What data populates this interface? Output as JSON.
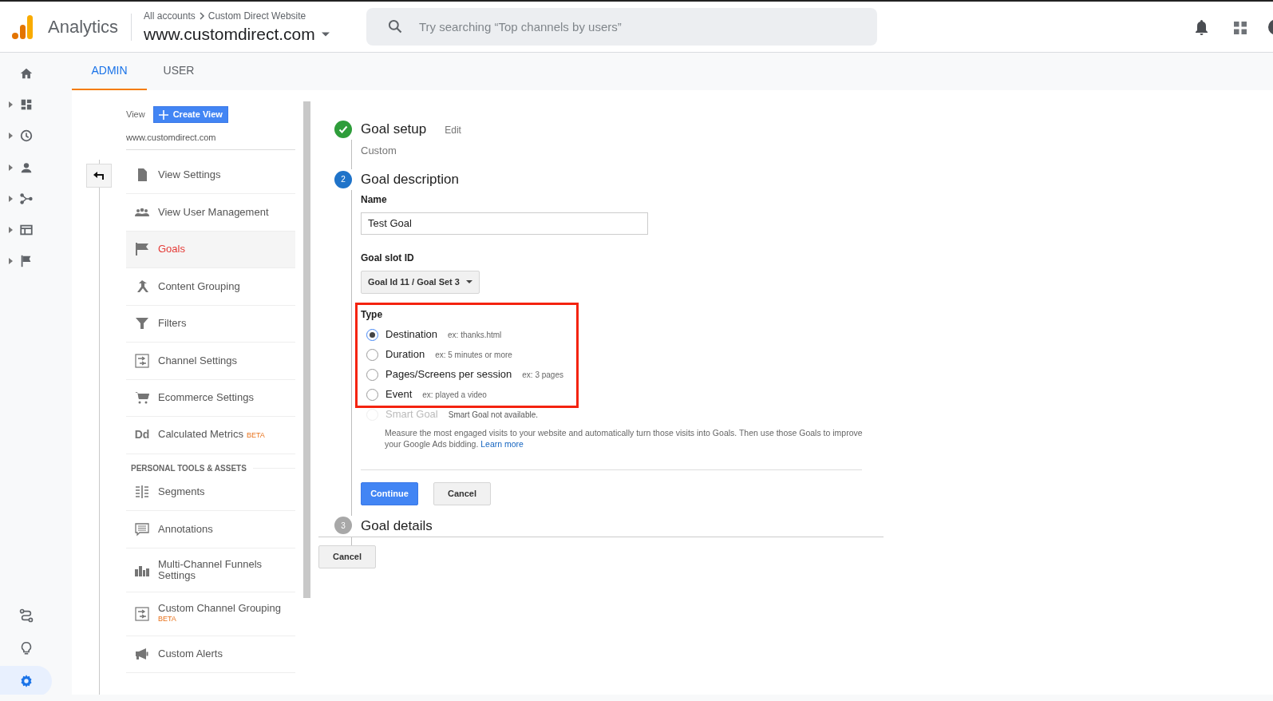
{
  "header": {
    "product": "Analytics",
    "breadcrumb": [
      "All accounts",
      "Custom Direct Website"
    ],
    "property": "www.customdirect.com",
    "search": {
      "placeholder": "Try searching “Top channels by users”"
    }
  },
  "rail": [
    {
      "kind": "home",
      "expandable": false,
      "selected": false
    },
    {
      "kind": "dashboard",
      "expandable": true,
      "selected": false
    },
    {
      "kind": "clock",
      "expandable": true,
      "selected": false
    },
    {
      "kind": "person",
      "expandable": true,
      "selected": false
    },
    {
      "kind": "fork",
      "expandable": true,
      "selected": false
    },
    {
      "kind": "table",
      "expandable": true,
      "selected": false
    },
    {
      "kind": "flag",
      "expandable": true,
      "selected": false
    }
  ],
  "rail_bottom": [
    {
      "kind": "route",
      "selected": false
    },
    {
      "kind": "bulb",
      "selected": false
    },
    {
      "kind": "gear",
      "selected": true
    }
  ],
  "tabs": [
    {
      "label": "ADMIN",
      "selected": true
    },
    {
      "label": "USER",
      "selected": false
    }
  ],
  "admin_nav": {
    "view_label": "View",
    "create_button": "Create View",
    "view_name": "www.customdirect.com",
    "items": [
      {
        "kind": "doc",
        "label": "View Settings",
        "selected": false
      },
      {
        "kind": "people",
        "label": "View User Management",
        "selected": false
      },
      {
        "kind": "flag",
        "label": "Goals",
        "selected": true
      },
      {
        "kind": "merge",
        "label": "Content Grouping",
        "selected": false
      },
      {
        "kind": "filter",
        "label": "Filters",
        "selected": false
      },
      {
        "kind": "channel",
        "label": "Channel Settings",
        "selected": false
      },
      {
        "kind": "cart",
        "label": "Ecommerce Settings",
        "selected": false
      },
      {
        "kind": "dd",
        "icon_text": "Dd",
        "label": "Calculated Metrics",
        "badge": "BETA",
        "selected": false
      }
    ],
    "section": "PERSONAL TOOLS & ASSETS",
    "tools": [
      {
        "kind": "segments",
        "label": "Segments",
        "selected": false
      },
      {
        "kind": "annotation",
        "label": "Annotations",
        "selected": false
      },
      {
        "kind": "bars",
        "label": "Multi-Channel Funnels Settings",
        "selected": false
      },
      {
        "kind": "channel",
        "label": "Custom Channel Grouping",
        "badge": "BETA",
        "selected": false
      },
      {
        "kind": "megaphone",
        "label": "Custom Alerts",
        "selected": false
      }
    ]
  },
  "steps": [
    {
      "completed": true,
      "active": false,
      "title": "Goal setup",
      "action": "Edit",
      "summary": "Custom"
    },
    {
      "completed": false,
      "active": true,
      "number": "2",
      "title": "Goal description"
    },
    {
      "completed": false,
      "active": false,
      "number": "3",
      "title": "Goal details"
    }
  ],
  "form": {
    "name_label": "Name",
    "name_value": "Test Goal",
    "slot_label": "Goal slot ID",
    "slot_value": "Goal Id 11 / Goal Set 3",
    "type_label": "Type",
    "types": [
      {
        "label": "Destination",
        "example": "ex: thanks.html",
        "selected": true,
        "disabled": false
      },
      {
        "label": "Duration",
        "example": "ex: 5 minutes or more",
        "selected": false,
        "disabled": false
      },
      {
        "label": "Pages/Screens per session",
        "example": "ex: 3 pages",
        "selected": false,
        "disabled": false
      },
      {
        "label": "Event",
        "example": "ex: played a video",
        "selected": false,
        "disabled": false
      },
      {
        "label": "Smart Goal",
        "example": "Smart Goal not available.",
        "selected": false,
        "disabled": true
      }
    ],
    "smart_note": "Measure the most engaged visits to your website and automatically turn those visits into Goals. Then use those Goals to improve your Google Ads bidding.",
    "smart_link": "Learn more",
    "continue": "Continue",
    "cancel": "Cancel"
  },
  "bottom_cancel": "Cancel"
}
